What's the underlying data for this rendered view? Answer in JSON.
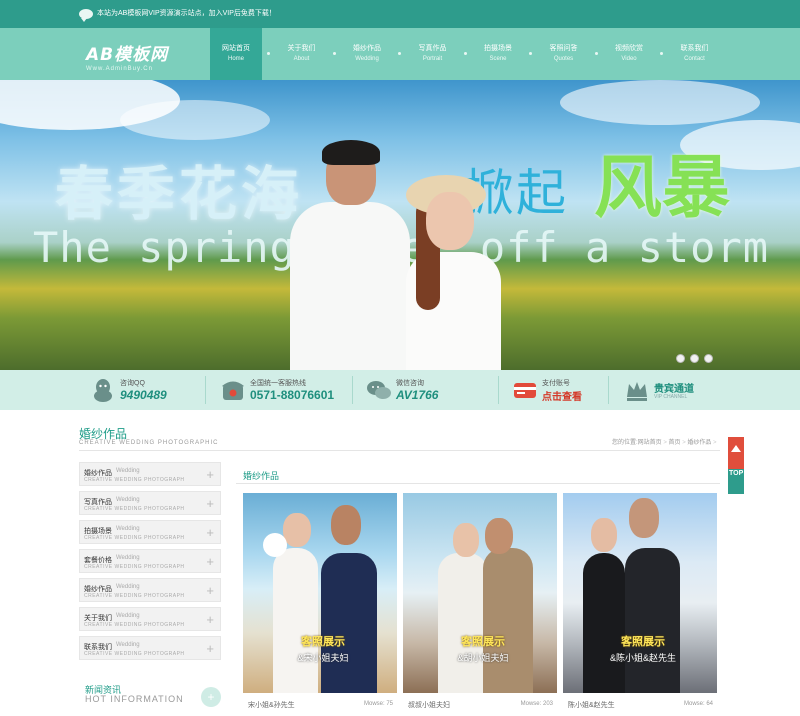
{
  "topbar": {
    "notice": "本站为AB模板网VIP资源演示站点，加入VIP后免费下载！"
  },
  "logo": {
    "text": "AB模板网",
    "sub": "Www.AdminBuy.Cn"
  },
  "nav": [
    {
      "zh": "网站首页",
      "en": "Home",
      "active": true
    },
    {
      "zh": "关于我们",
      "en": "About",
      "active": false
    },
    {
      "zh": "婚纱作品",
      "en": "Wedding",
      "active": false
    },
    {
      "zh": "写真作品",
      "en": "Portrait",
      "active": false
    },
    {
      "zh": "拍摄场景",
      "en": "Scene",
      "active": false
    },
    {
      "zh": "客照问答",
      "en": "Quotes",
      "active": false
    },
    {
      "zh": "视频欣赏",
      "en": "Video",
      "active": false
    },
    {
      "zh": "联系我们",
      "en": "Contact",
      "active": false
    }
  ],
  "banner": {
    "headline_1": "春季花海",
    "headline_2": "掀起",
    "headline_3": "风暴",
    "english_line": "The spring fl     et off a storm",
    "slide_count": 3
  },
  "contact": [
    {
      "label": "咨询QQ",
      "value": "9490489",
      "icon": "qq-icon"
    },
    {
      "label": "全国统一客服热线",
      "value": "0571-88076601",
      "icon": "phone-icon"
    },
    {
      "label": "微信咨询",
      "value": "AV1766",
      "icon": "wechat-icon"
    },
    {
      "label": "支付账号",
      "value": "点击查看",
      "icon": "card-icon"
    },
    {
      "label": "贵宾通道",
      "value": "VIP CHANNEL",
      "icon": "crown-icon"
    }
  ],
  "section": {
    "title": "婚纱作品",
    "subtitle": "CREATIVE WEDDING PHOTOGRAPHIC"
  },
  "breadcrumb": {
    "home": "您的位置:网站首页",
    "sep1": " > ",
    "level1": "首页",
    "sep2": " > ",
    "level2": "婚纱作品",
    "sep3": " >"
  },
  "sidebar": [
    {
      "zh": "婚纱作品",
      "en": "Wedding",
      "sub": "CREATIVE WEDDING PHOTOGRAPH"
    },
    {
      "zh": "写真作品",
      "en": "Wedding",
      "sub": "CREATIVE WEDDING PHOTOGRAPH"
    },
    {
      "zh": "拍摄场景",
      "en": "Wedding",
      "sub": "CREATIVE WEDDING PHOTOGRAPH"
    },
    {
      "zh": "套餐价格",
      "en": "Wedding",
      "sub": "CREATIVE WEDDING PHOTOGRAPH"
    },
    {
      "zh": "婚纱作品",
      "en": "Wedding",
      "sub": "CREATIVE WEDDING PHOTOGRAPH"
    },
    {
      "zh": "关于我们",
      "en": "Wedding",
      "sub": "CREATIVE WEDDING PHOTOGRAPH"
    },
    {
      "zh": "联系我们",
      "en": "Wedding",
      "sub": "CREATIVE WEDDING PHOTOGRAPH"
    }
  ],
  "news": {
    "title": "新闻资讯",
    "sub": "HOT INFORMATION",
    "badge": "+"
  },
  "content": {
    "title": "婚纱作品",
    "cards": [
      {
        "name": "宋小姐&孙先生",
        "views": "Mowse: 75",
        "cap1": "客照展示",
        "cap2": "&宋小姐夫妇"
      },
      {
        "name": "叔叔小姐夫妇",
        "views": "Mowse: 203",
        "cap1": "客照展示",
        "cap2": "&胡小姐夫妇"
      },
      {
        "name": "陈小姐&赵先生",
        "views": "Mowse: 64",
        "cap1": "客照展示",
        "cap2": "&陈小姐&赵先生"
      }
    ]
  },
  "totop": {
    "label": "TOP"
  }
}
